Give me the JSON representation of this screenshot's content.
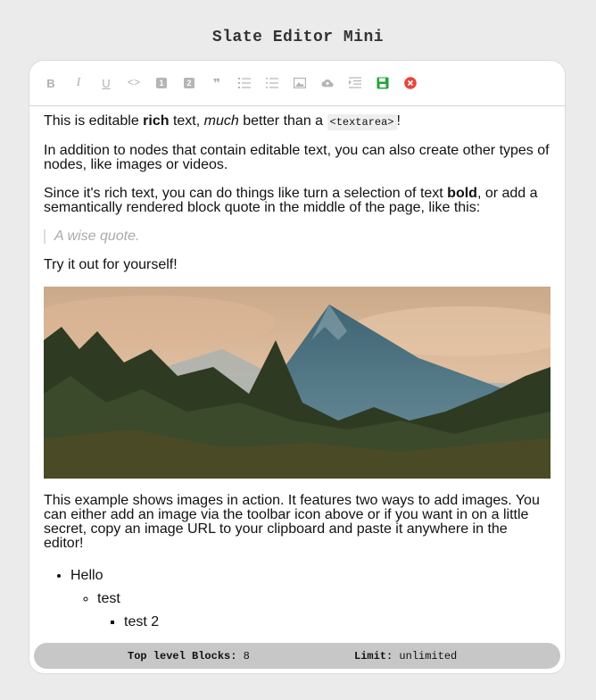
{
  "app": {
    "title": "Slate Editor Mini"
  },
  "toolbar": {
    "buttons": [
      {
        "name": "bold-button",
        "glyph": "B"
      },
      {
        "name": "italic-button",
        "glyph": "I"
      },
      {
        "name": "underline-button",
        "glyph": "U"
      },
      {
        "name": "code-button",
        "glyph": "<>"
      },
      {
        "name": "heading-one-button",
        "glyph": "1"
      },
      {
        "name": "heading-two-button",
        "glyph": "2"
      },
      {
        "name": "block-quote-button",
        "glyph": "❞"
      },
      {
        "name": "numbered-list-button",
        "icon": "numbered-list-icon"
      },
      {
        "name": "bulleted-list-button",
        "icon": "bulleted-list-icon"
      },
      {
        "name": "image-button",
        "icon": "image-icon"
      },
      {
        "name": "upload-button",
        "icon": "cloud-upload-icon"
      },
      {
        "name": "indent-button",
        "icon": "indent-icon"
      },
      {
        "name": "save-button",
        "icon": "save-icon",
        "color": "#22a33a"
      },
      {
        "name": "cancel-button",
        "icon": "close-circle-icon",
        "color": "#e8453c"
      }
    ]
  },
  "content": {
    "p1": {
      "a": "This is editable ",
      "b": "rich",
      "c": " text, ",
      "d": "much",
      "e": " better than a ",
      "code": "<textarea>",
      "f": "!"
    },
    "p2": "In addition to nodes that contain editable text, you can also create other types of nodes, like images or videos.",
    "p3": {
      "a": "Since it's rich text, you can do things like turn a selection of text ",
      "b": "bold",
      "c": ", or add a semantically rendered block quote in the middle of the page, like this:"
    },
    "quote": "A wise quote.",
    "p4": "Try it out for yourself!",
    "p5": "This example shows images in action. It features two ways to add images. You can either add an image via the toolbar icon above or if you want in on a little secret, copy an image URL to your clipboard and paste it anywhere in the editor!",
    "list": {
      "l1": "Hello",
      "l2": "test",
      "l3": "test 2"
    }
  },
  "status": {
    "blocks_label": "Top level Blocks:",
    "blocks_value": "8",
    "limit_label": "Limit:",
    "limit_value": "unlimited"
  },
  "colors": {
    "background": "#ebebeb",
    "status_bar": "#c7c7c7",
    "icon_gray": "#b0b0b0",
    "save": "#22a33a",
    "cancel": "#e8453c"
  }
}
